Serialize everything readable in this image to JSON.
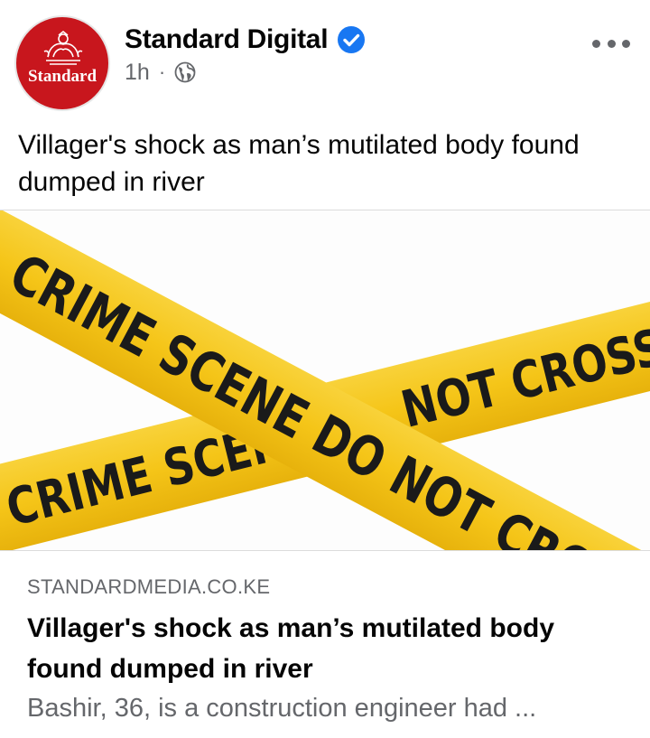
{
  "post": {
    "page_name": "Standard Digital",
    "verified_icon": "verified-badge-icon",
    "timestamp": "1h",
    "separator": "·",
    "audience_icon": "globe-icon",
    "more_icon": "more-options-icon",
    "avatar_text": "Standard",
    "avatar_color": "#c8161d",
    "text": "Villager's shock as man’s mutilated body found dumped in river"
  },
  "image": {
    "tape_color": "#f5c518",
    "tape_text_1": "CRIME SCENE DO NOT CROSS",
    "tape_text_2": "CRIME SCENE",
    "tape_text_3": "NOT CROSS"
  },
  "link_preview": {
    "domain": "STANDARDMEDIA.CO.KE",
    "title": "Villager's shock as man’s mutilated body found dumped in river",
    "description": "Bashir, 36, is a construction engineer had ..."
  },
  "colors": {
    "accent_blue": "#1877f2",
    "secondary_text": "#65676b"
  }
}
